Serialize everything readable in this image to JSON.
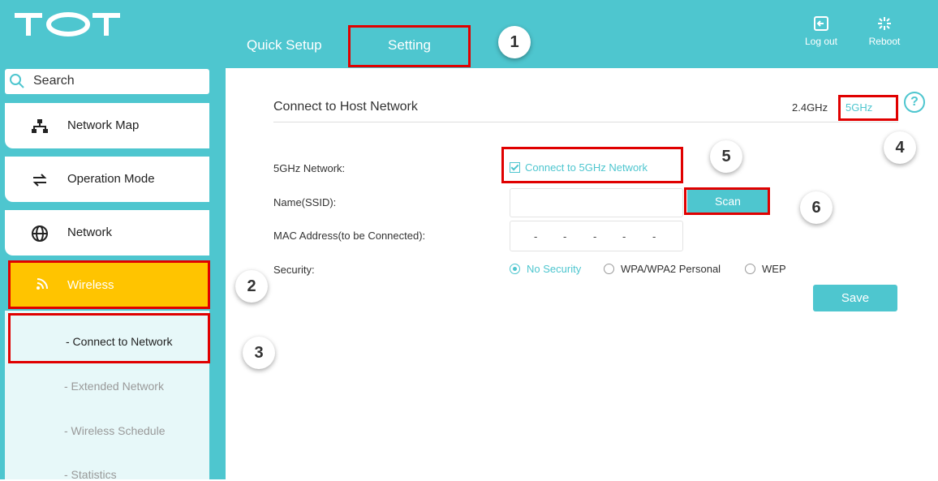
{
  "brand": {
    "logo_text": "TOT"
  },
  "header": {
    "tabs": [
      {
        "label": "Quick Setup"
      },
      {
        "label": "Setting"
      }
    ],
    "logout_label": "Log out",
    "reboot_label": "Reboot"
  },
  "sidebar": {
    "search_placeholder": "Search",
    "items": [
      {
        "label": "Network Map",
        "icon": "network-map-icon"
      },
      {
        "label": "Operation Mode",
        "icon": "operation-mode-icon"
      },
      {
        "label": "Network",
        "icon": "globe-icon"
      },
      {
        "label": "Wireless",
        "icon": "wireless-icon"
      }
    ],
    "submenu": [
      {
        "label": "- Connect to Network"
      },
      {
        "label": "- Extended Network"
      },
      {
        "label": "- Wireless Schedule"
      },
      {
        "label": "- Statistics"
      }
    ]
  },
  "main": {
    "title": "Connect to Host Network",
    "band_24": "2.4GHz",
    "band_5": "5GHz",
    "help_symbol": "?",
    "fields": {
      "network_label": "5GHz Network:",
      "network_checkbox": "Connect to 5GHz Network",
      "ssid_label": "Name(SSID):",
      "ssid_value": "",
      "scan_button": "Scan",
      "mac_label": "MAC Address(to be Connected):",
      "mac_separators": [
        "-",
        "-",
        "-",
        "-",
        "-"
      ],
      "security_label": "Security:",
      "security_options": [
        "No Security",
        "WPA/WPA2 Personal",
        "WEP"
      ],
      "security_selected": "No Security"
    },
    "save_button": "Save"
  },
  "annotations": {
    "callouts": [
      "1",
      "2",
      "3",
      "4",
      "5",
      "6"
    ]
  },
  "colors": {
    "accent": "#4ec6cf",
    "highlight": "#ffc400",
    "annotation": "#e00000"
  }
}
